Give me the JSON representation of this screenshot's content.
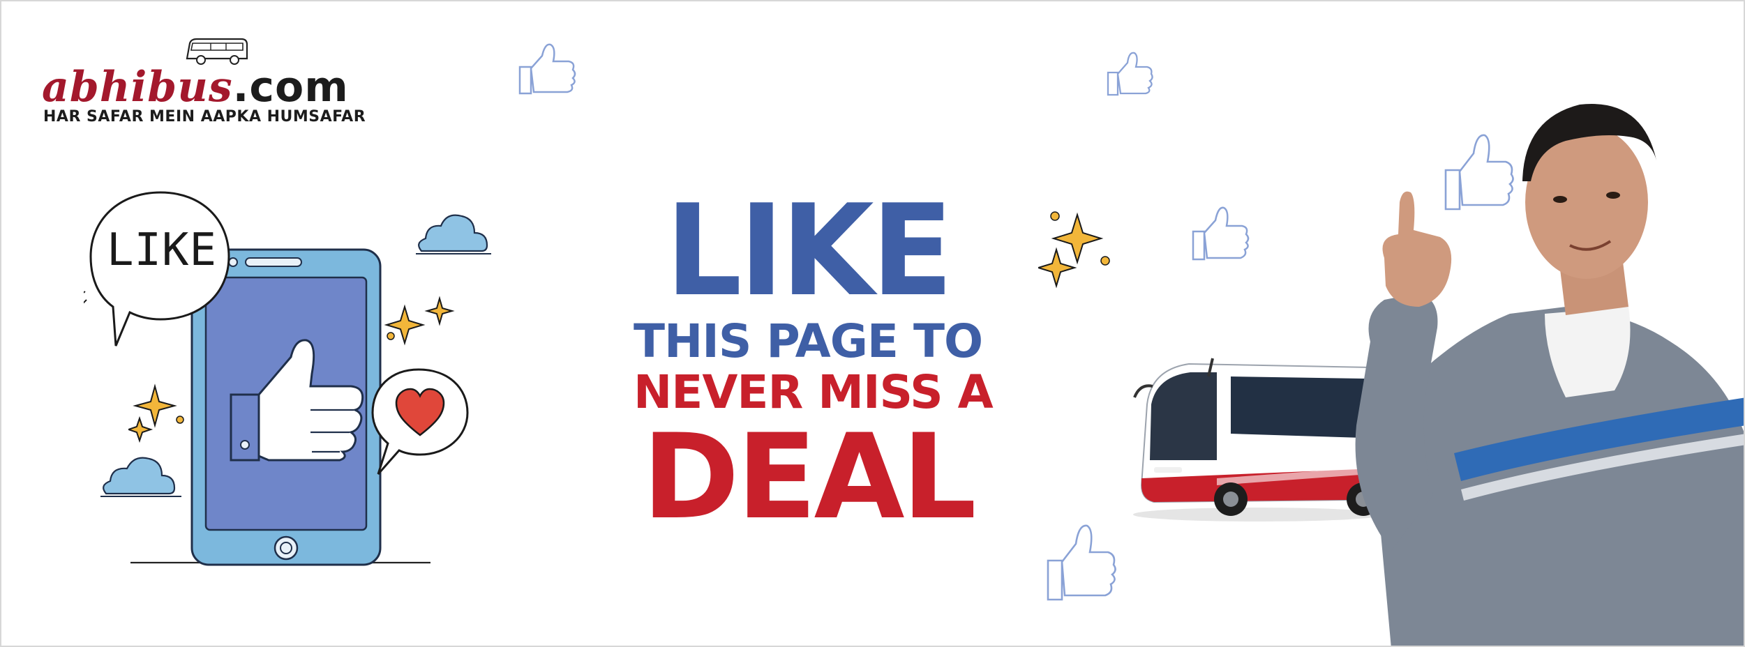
{
  "logo": {
    "brand": "abhibus",
    "tld": ".com",
    "tagline": "HAR SAFAR MEIN AAPKA HUMSAFAR"
  },
  "speech_bubble": {
    "text": "LIKE"
  },
  "headline": {
    "line1": "LIKE",
    "line2": "THIS PAGE TO",
    "line3": "NEVER MISS A",
    "line4": "DEAL"
  },
  "colors": {
    "headline_blue": "#3f5fa6",
    "headline_red": "#c8202b",
    "logo_red": "#a3182c",
    "phone_blue": "#6f86c9",
    "phone_frame": "#7cb8dd",
    "cloud": "#8fc3e4",
    "sparkle": "#f2b63a",
    "heart": "#e0473a"
  },
  "icons": [
    "thumbs-up-icon",
    "heart-icon",
    "sparkle-icon",
    "cloud-icon",
    "bus-icon",
    "speech-bubble-icon"
  ]
}
